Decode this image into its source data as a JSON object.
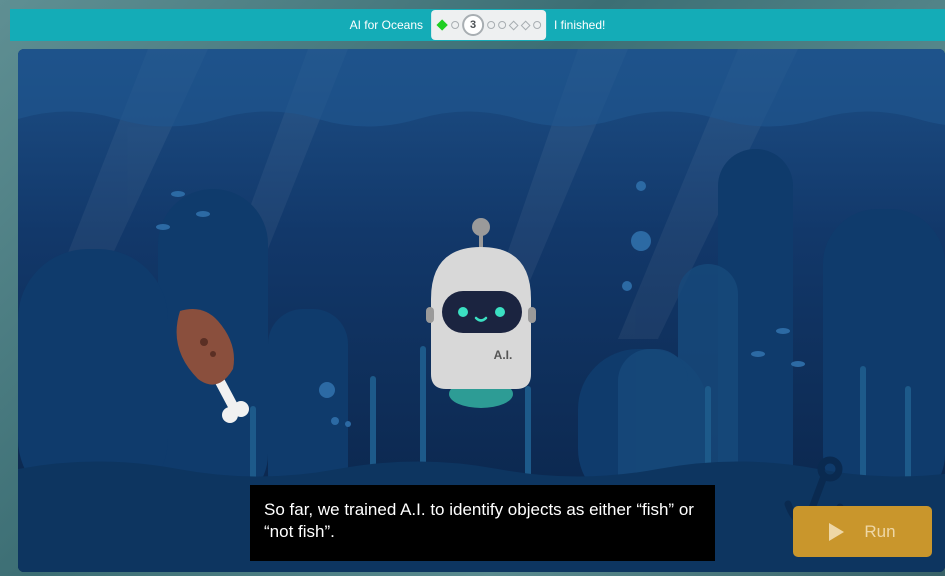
{
  "header": {
    "course_title": "AI for Oceans",
    "current_lesson": "3",
    "finished_label": "I finished!"
  },
  "robot": {
    "label": "A.I."
  },
  "caption": {
    "text": "So far, we trained A.I. to identify objects as either “fish” or “not fish”."
  },
  "run_button": {
    "label": "Run"
  },
  "colors": {
    "topbar": "#14acb7",
    "ocean_dark": "#0b2a55",
    "run_button": "#c9962c",
    "progress_complete": "#1fcf23"
  }
}
